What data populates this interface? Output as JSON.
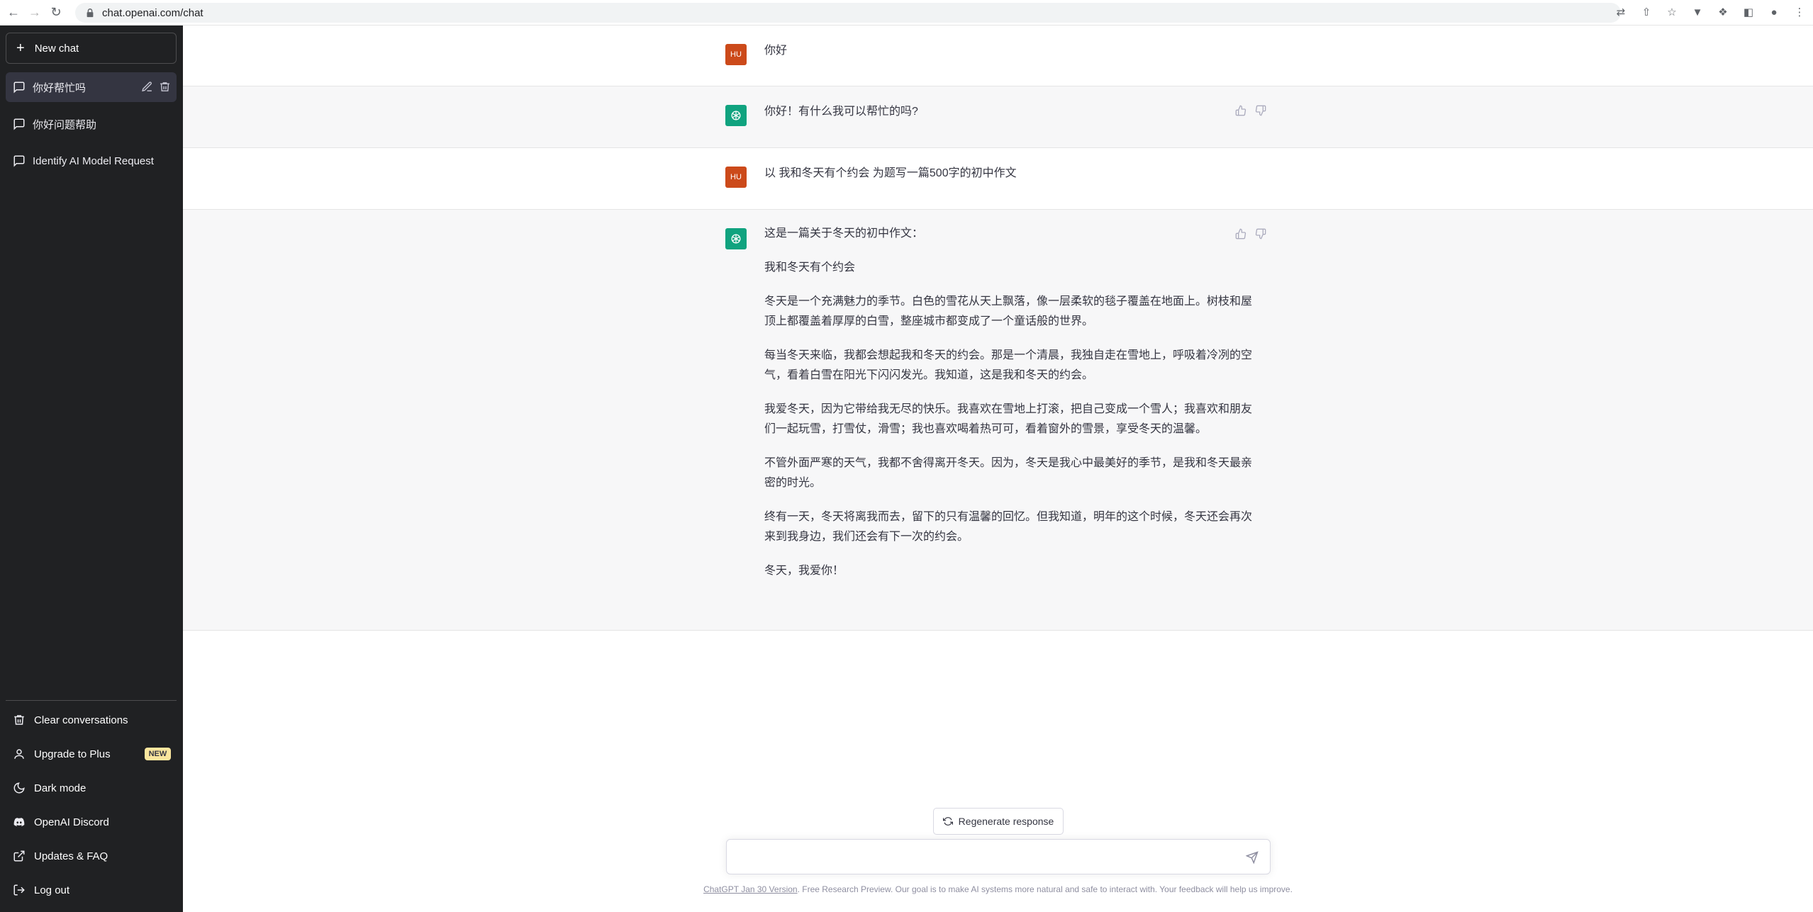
{
  "browser": {
    "url": "chat.openai.com/chat"
  },
  "sidebar": {
    "new_chat_label": "New chat",
    "conversations": [
      {
        "title": "你好帮忙吗",
        "active": true
      },
      {
        "title": "你好问题帮助",
        "active": false
      },
      {
        "title": "Identify AI Model Request",
        "active": false
      }
    ],
    "bottom": {
      "clear": "Clear conversations",
      "upgrade": "Upgrade to Plus",
      "upgrade_badge": "NEW",
      "dark_mode": "Dark mode",
      "discord": "OpenAI Discord",
      "updates": "Updates & FAQ",
      "logout": "Log out"
    }
  },
  "messages": [
    {
      "role": "user",
      "avatar": "HU",
      "text": "你好"
    },
    {
      "role": "assistant",
      "text": "你好！有什么我可以帮忙的吗?"
    },
    {
      "role": "user",
      "avatar": "HU",
      "text": "以 我和冬天有个约会 为题写一篇500字的初中作文"
    },
    {
      "role": "assistant",
      "paragraphs": [
        "这是一篇关于冬天的初中作文：",
        "我和冬天有个约会",
        "冬天是一个充满魅力的季节。白色的雪花从天上飘落，像一层柔软的毯子覆盖在地面上。树枝和屋顶上都覆盖着厚厚的白雪，整座城市都变成了一个童话般的世界。",
        "每当冬天来临，我都会想起我和冬天的约会。那是一个清晨，我独自走在雪地上，呼吸着冷冽的空气，看着白雪在阳光下闪闪发光。我知道，这是我和冬天的约会。",
        "我爱冬天，因为它带给我无尽的快乐。我喜欢在雪地上打滚，把自己变成一个雪人；我喜欢和朋友们一起玩雪，打雪仗，滑雪；我也喜欢喝着热可可，看着窗外的雪景，享受冬天的温馨。",
        "不管外面严寒的天气，我都不舍得离开冬天。因为，冬天是我心中最美好的季节，是我和冬天最亲密的时光。",
        "终有一天，冬天将离我而去，留下的只有温馨的回忆。但我知道，明年的这个时候，冬天还会再次来到我身边，我们还会有下一次的约会。",
        "冬天，我爱你！"
      ]
    }
  ],
  "composer": {
    "regenerate_label": "Regenerate response",
    "placeholder": ""
  },
  "footer": {
    "version_link": "ChatGPT Jan 30 Version",
    "text": ". Free Research Preview. Our goal is to make AI systems more natural and safe to interact with. Your feedback will help us improve."
  },
  "colors": {
    "sidebar_bg": "#202123",
    "assistant_bg": "#f7f7f8",
    "user_avatar": "#cc4a1a",
    "gpt_avatar": "#10a37f",
    "badge": "#fae69e"
  }
}
